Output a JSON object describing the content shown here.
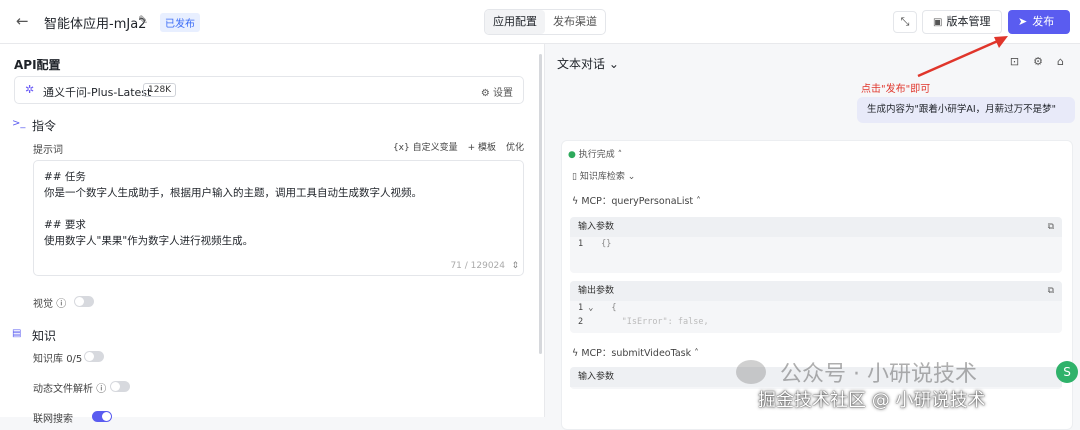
{
  "header": {
    "app_title": "智能体应用-mJa2",
    "status": "已发布",
    "tabs": [
      {
        "label": "应用配置",
        "active": true
      },
      {
        "label": "发布渠道",
        "active": false
      }
    ],
    "version_label": "版本管理",
    "publish_label": "发布"
  },
  "left": {
    "api_title": "API配置",
    "model": {
      "name": "通义千问-Plus-Latest",
      "context": "128K",
      "settings_label": "设置"
    },
    "instructions": {
      "title": "指令",
      "prompt_label": "提示词",
      "actions": [
        "{x} 自定义变量",
        "+ 模板",
        "优化"
      ],
      "lines": [
        "## 任务",
        "你是一个数字人生成助手，根据用户输入的主题，调用工具自动生成数字人视频。",
        "",
        "## 要求",
        "使用数字人\"果果\"作为数字人进行视频生成。"
      ],
      "count": "71 / 129024"
    },
    "vision_label": "视觉",
    "knowledge": {
      "title": "知识",
      "kb_label": "知识库",
      "kb_count": "0/5",
      "dynamic_label": "动态文件解析",
      "search_label": "联网搜索"
    }
  },
  "right": {
    "chat_mode": "文本对话",
    "annotation": "点击\"发布\"即可",
    "user_message": "生成内容为\"跟着小研学AI，月薪过万不是梦\"",
    "run": {
      "status": "执行完成",
      "kb_search": "知识库检索",
      "mcp1": "MCP：queryPersonaList",
      "input_label": "输入参数",
      "input_code": "{}",
      "output_label": "输出参数",
      "output_line1": "{",
      "output_line2": "\"IsError\": false,",
      "mcp2": "MCP：submitVideoTask",
      "input_label2": "输入参数"
    }
  },
  "watermark": {
    "line1": "公众号 · 小研说技术",
    "line2": "掘金技术社区 @ 小研说技术"
  },
  "colors": {
    "accent": "#5a5cf0",
    "annotation": "#e0352b"
  }
}
